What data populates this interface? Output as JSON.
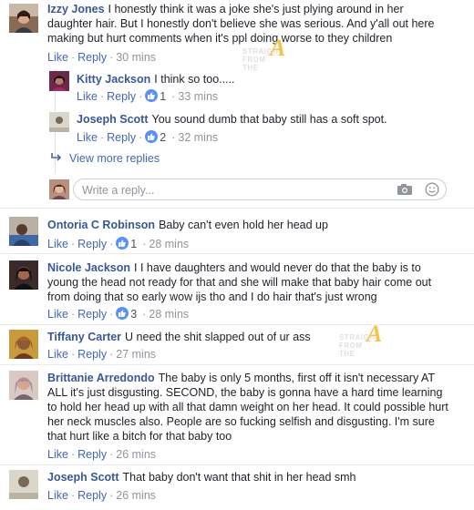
{
  "action_labels": {
    "like": "Like",
    "reply": "Reply"
  },
  "comments": [
    {
      "author": "Izzy Jones",
      "text": "I honestly think it was a joke she's just plying around in her daughter hair. But I honestly don't believe she was serious. And y'all out here making but hurt comments when it's ppl doing worse to they children",
      "time": "30 mins",
      "likes": ""
    },
    {
      "author": "Kitty Jackson",
      "text": "I think so too.....",
      "time": "33 mins",
      "likes": "1"
    },
    {
      "author": "Joseph Scott",
      "text": "You sound dumb that baby still has a soft spot.",
      "time": "32 mins",
      "likes": "2"
    },
    {
      "author": "Ontoria C Robinson",
      "text": "Baby can't even hold her head up",
      "time": "28 mins",
      "likes": "1"
    },
    {
      "author": "Nicole Jackson",
      "text": "I I have daughters and would never do that the baby is to young the head not ready for that and she will make that baby hair come out from doing that so early wow ijs tho and I do hair that's just wrong",
      "time": "28 mins",
      "likes": "3"
    },
    {
      "author": "Tiffany Carter",
      "text": "U need the shit slapped out of ur ass",
      "time": "27 mins",
      "likes": ""
    },
    {
      "author": "Brittanie Arredondo",
      "text": "The baby is only 5 months, first off it isn't necessary AT ALL it's just disgusting. SECOND, the baby is gonna have a hard time learning to hold her head up with all that damn weight on her head. It could possible hurt her neck muscles also. People are so fucking selfish and disgusting. I'm sure that hurt like a bitch for that baby too",
      "time": "26 mins",
      "likes": ""
    },
    {
      "author": "Joseph Scott",
      "text": "That baby don't want that shit in her head smh",
      "time": "26 mins",
      "likes": ""
    }
  ],
  "view_more_replies": "View more replies",
  "reply_box": {
    "placeholder": "Write a reply..."
  },
  "watermark": {
    "line1": "STRAIGHT",
    "line2": "FROM",
    "line3": "THE",
    "mark": "A"
  },
  "icons": {
    "like": "thumbs-up-icon",
    "arrow": "reply-arrow-icon",
    "camera": "camera-icon",
    "emoji": "smiley-icon"
  },
  "colors": {
    "author": "#365899",
    "action": "#4267b2",
    "meta": "#90949c",
    "like_badge": "#5890ff"
  }
}
